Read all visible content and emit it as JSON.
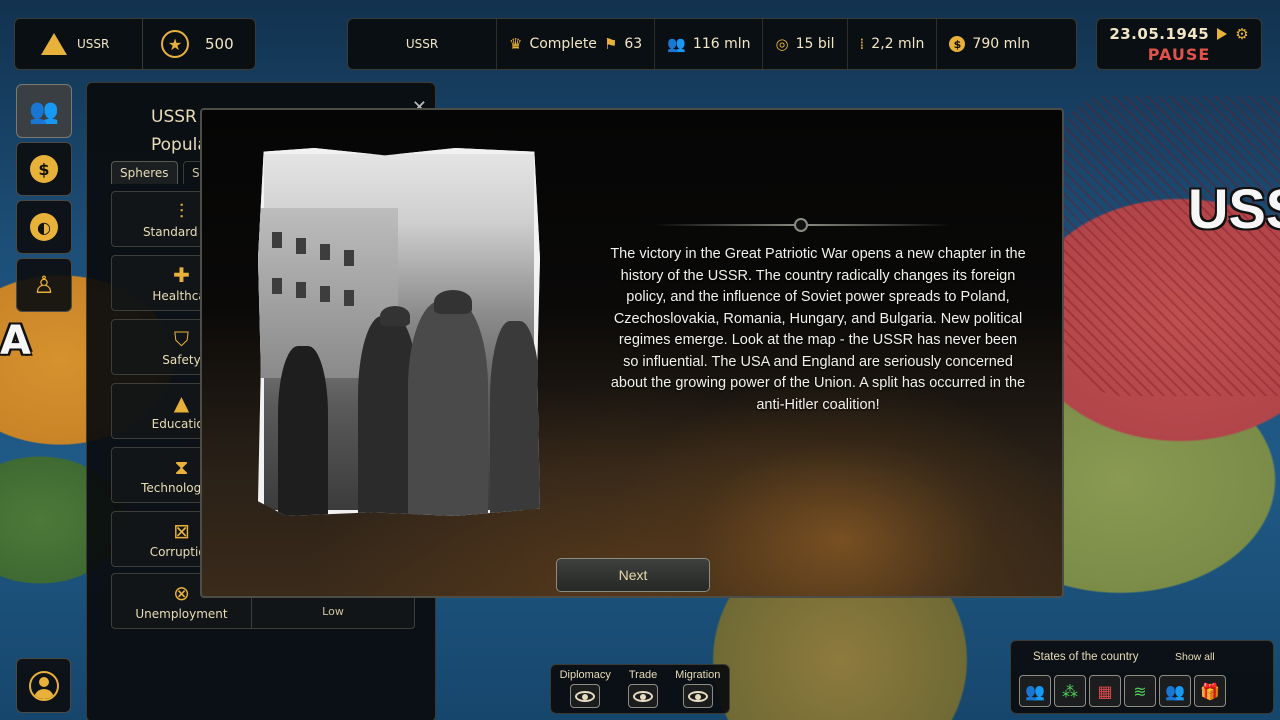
{
  "top_left": {
    "country": "USSR",
    "score": "500",
    "country_icon": "triangle-flag-icon",
    "score_icon": "star-icon"
  },
  "stats": {
    "country": "USSR",
    "status": "Complete",
    "flags": "63",
    "population": "116 mln",
    "money": "15 bil",
    "ammo": "2,2 mln",
    "dollars": "790 mln"
  },
  "date": {
    "value": "23.05.1945",
    "state": "PAUSE"
  },
  "side_buttons": [
    "population-icon",
    "economy-icon",
    "globe-icon",
    "leader-icon"
  ],
  "population_panel": {
    "title_line1": "USSR",
    "title_line2": "Popula",
    "tab_spheres": "Spheres",
    "tab_second": "S",
    "spheres": [
      {
        "label": "Standard of l",
        "value": "",
        "icon": "people-standard-icon"
      },
      {
        "label": "Healthcar",
        "value": "",
        "icon": "medkit-icon"
      },
      {
        "label": "Safety",
        "value": "",
        "icon": "shield-icon"
      },
      {
        "label": "Education",
        "value": "",
        "icon": "graduation-cap-icon"
      },
      {
        "label": "Technological",
        "value": "",
        "icon": "hourglass-icon"
      },
      {
        "label": "Corruption",
        "value": "",
        "icon": "corruption-icon"
      },
      {
        "label": "Unemployment",
        "value": "Low",
        "icon": "unemployment-icon"
      }
    ]
  },
  "map": {
    "label": "USSR",
    "left_letter": "A"
  },
  "event": {
    "text": "The victory in the Great Patriotic War opens a new chapter in the history of the USSR. The country radically changes its foreign policy, and the influence of Soviet power spreads to Poland, Czechoslovakia, Romania, Hungary, and Bulgaria. New political regimes emerge. Look at the map - the USSR has never been so influential. The USA and England are seriously concerned about the growing power of the Union. A split has occurred in the anti-Hitler coalition!",
    "next_label": "Next"
  },
  "view_toggles": [
    {
      "label": "Diplomacy"
    },
    {
      "label": "Trade"
    },
    {
      "label": "Migration"
    }
  ],
  "states": {
    "title": "States of the country",
    "show_all": "Show all",
    "icons": [
      {
        "name": "happy-people-icon",
        "color": "#4fcf5a"
      },
      {
        "name": "crowd-people-icon",
        "color": "#4fcf5a"
      },
      {
        "name": "red-factory-icon",
        "color": "#e04a4a"
      },
      {
        "name": "money-stack-icon",
        "color": "#4fcf5a"
      },
      {
        "name": "worker-people-icon",
        "color": "#4fcf5a"
      },
      {
        "name": "red-gift-icon",
        "color": "#e04a4a"
      }
    ]
  },
  "colors": {
    "accent": "#e8b13a",
    "pause": "#e0524a",
    "ussr_territory": "#c0504f"
  }
}
